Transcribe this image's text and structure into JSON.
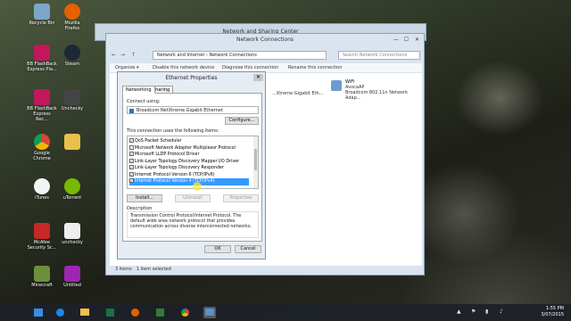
{
  "desktop": {
    "icons": [
      {
        "label": "Recycle Bin",
        "icon": "recycle-bin-icon",
        "color": "#7aa7c7"
      },
      {
        "label": "Mozilla Firefox",
        "icon": "firefox-icon",
        "color": "#e66000"
      },
      {
        "label": "BB FlashBack Express Pla...",
        "icon": "flashback-player-icon",
        "color": "#c2185b"
      },
      {
        "label": "Steam",
        "icon": "steam-icon",
        "color": "#1b2838"
      },
      {
        "label": "BB FlashBack Express Rec...",
        "icon": "flashback-recorder-icon",
        "color": "#c2185b"
      },
      {
        "label": "Unchecky",
        "icon": "unchecky-icon",
        "color": "#444"
      },
      {
        "label": "Google Chrome",
        "icon": "chrome-icon",
        "color": "#4caf50"
      },
      {
        "label": "",
        "icon": "folder-icon",
        "color": "#e8c14b"
      },
      {
        "label": "iTunes",
        "icon": "itunes-icon",
        "color": "#f4f4f4"
      },
      {
        "label": "uTorrent",
        "icon": "utorrent-icon",
        "color": "#77b900"
      },
      {
        "label": "McAfee Security Sc...",
        "icon": "mcafee-icon",
        "color": "#c62828"
      },
      {
        "label": "unchecky",
        "icon": "unchecky-file-icon",
        "color": "#eeeeee"
      },
      {
        "label": "Minecraft",
        "icon": "minecraft-icon",
        "color": "#6d8f3a"
      },
      {
        "label": "Untitled",
        "icon": "untitled-file-icon",
        "color": "#9c27b0"
      }
    ]
  },
  "nsc_window": {
    "title": "Network and Sharing Center"
  },
  "nc_window": {
    "title": "Network Connections",
    "address": "Network and Internet  ›  Network Connections",
    "search_placeholder": "Search Network Connections",
    "commands": [
      "Organize ▾",
      "Disable this network device",
      "Diagnose this connection",
      "Rename this connection"
    ],
    "adapters": [
      {
        "name": "",
        "detail": "...Xtreme Gigabit Eth..."
      },
      {
        "name": "WiFi",
        "detail1": "AvocaAP",
        "detail2": "Broadcom 802.11n Network Adap..."
      }
    ],
    "status_items": "3 items",
    "status_selected": "1 item selected"
  },
  "dialog": {
    "title": "Ethernet Properties",
    "close": "✕",
    "tabs": [
      "Networking",
      "Sharing"
    ],
    "connect_using_label": "Connect using:",
    "adapter": "Broadcom NetXtreme Gigabit Ethernet",
    "configure_button": "Configure...",
    "items_label": "This connection uses the following items:",
    "items": [
      {
        "label": "QoS Packet Scheduler",
        "checked": true,
        "selected": false
      },
      {
        "label": "Microsoft Network Adapter Multiplexor Protocol",
        "checked": false,
        "selected": false
      },
      {
        "label": "Microsoft LLDP Protocol Driver",
        "checked": true,
        "selected": false
      },
      {
        "label": "Link-Layer Topology Discovery Mapper I/O Driver",
        "checked": true,
        "selected": false
      },
      {
        "label": "Link-Layer Topology Discovery Responder",
        "checked": true,
        "selected": false
      },
      {
        "label": "Internet Protocol Version 6 (TCP/IPv6)",
        "checked": true,
        "selected": false
      },
      {
        "label": "Internet Protocol Version 4 (TCP/IPv4)",
        "checked": true,
        "selected": true
      }
    ],
    "install_button": "Install...",
    "uninstall_button": "Uninstall",
    "properties_button": "Properties",
    "description_label": "Description",
    "description": "Transmission Control Protocol/Internet Protocol. The default wide area network protocol that provides communication across diverse interconnected networks.",
    "ok_button": "OK",
    "cancel_button": "Cancel"
  },
  "taskbar": {
    "apps": [
      {
        "icon": "start-icon",
        "color": "#3a8ee6"
      },
      {
        "icon": "ie-icon",
        "color": "#1e88e5"
      },
      {
        "icon": "explorer-icon",
        "color": "#f2c14e"
      },
      {
        "icon": "store-icon",
        "color": "#2e7d32"
      },
      {
        "icon": "excel-icon",
        "color": "#1d7044"
      },
      {
        "icon": "firefox-taskbar-icon",
        "color": "#e66000"
      },
      {
        "icon": "chrome-taskbar-icon",
        "color": "#4caf50"
      },
      {
        "icon": "camera-icon",
        "color": "#c2185b"
      },
      {
        "icon": "network-taskbar-icon",
        "color": "#5b8fd1"
      }
    ],
    "time": "1:55 PM",
    "date": "3/07/2015"
  }
}
